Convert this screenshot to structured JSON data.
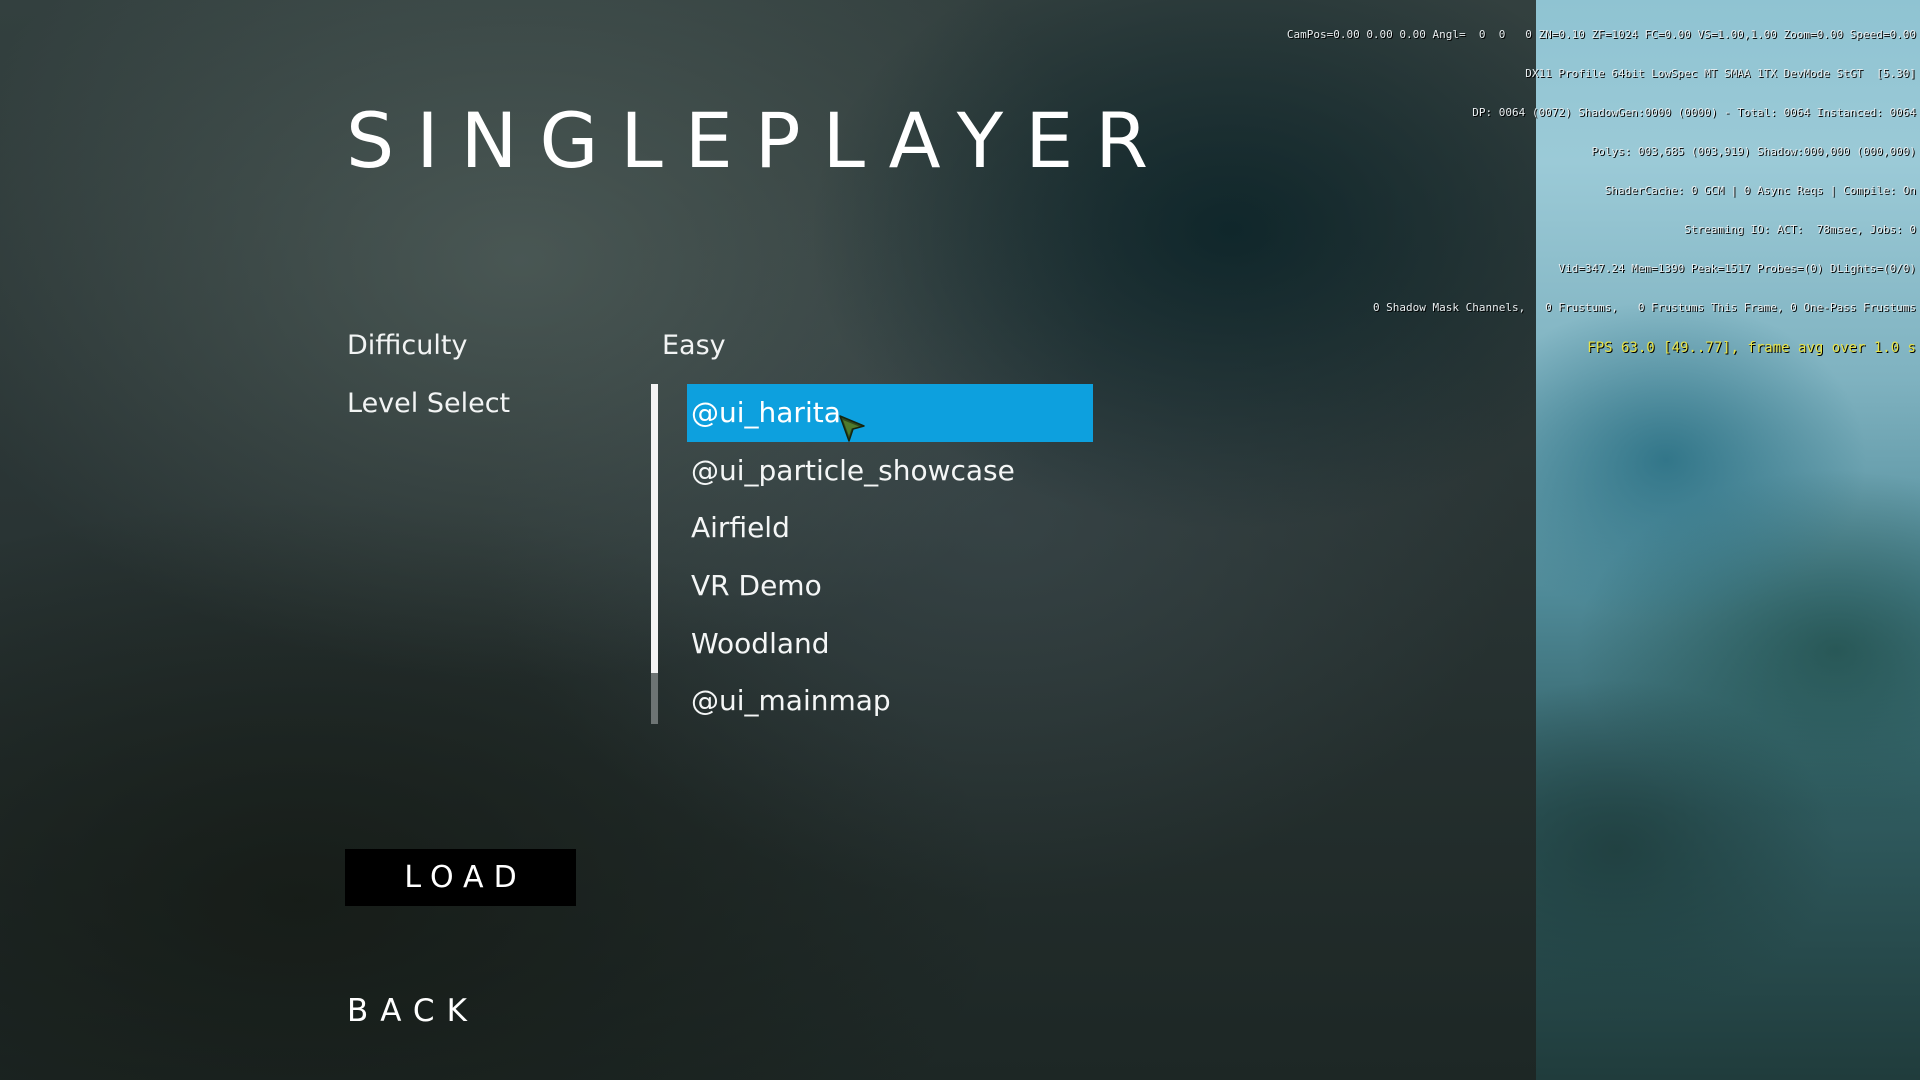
{
  "debug": {
    "lines": [
      "CamPos=0.00 0.00 0.00 Angl=  0  0   0 ZN=0.10 ZF=1024 FC=0.00 VS=1.00,1.00 Zoom=0.00 Speed=0.00",
      "DX11 Profile 64bit LowSpec MT SMAA 1TX DevMode StGT  [5.30]",
      "DP: 0064 (0072) ShadowGen:0000 (0000) - Total: 0064 Instanced: 0064",
      "Polys: 003,685 (003,919) Shadow:000,000 (000,000)",
      "ShaderCache: 0 GCM | 0 Async Reqs | Compile: On",
      "Streaming IO: ACT:  78msec, Jobs: 0",
      "Vid=347.24 Mem=1390 Peak=1517 Probes=(0) DLights=(0/0)",
      "0 Shadow Mask Channels,   0 Frustums,   0 Frustums This Frame, 0 One-Pass Frustums"
    ],
    "fps": "FPS 63.0 [49..77], frame avg over 1.0 s"
  },
  "title": "SINGLEPLAYER",
  "difficulty": {
    "label": "Difficulty",
    "value": "Easy"
  },
  "level_select": {
    "label": "Level Select",
    "levels": [
      "@ui_harita",
      "@ui_particle_showcase",
      "Airfield",
      "VR Demo",
      "Woodland",
      "@ui_mainmap"
    ],
    "selected_index": 0,
    "scroll_visible_fraction": 0.85
  },
  "buttons": {
    "load": "LOAD",
    "back": "BACK"
  },
  "colors": {
    "highlight": "#0da0de",
    "load_bg": "#000000",
    "fps_text": "#e6e34a"
  }
}
